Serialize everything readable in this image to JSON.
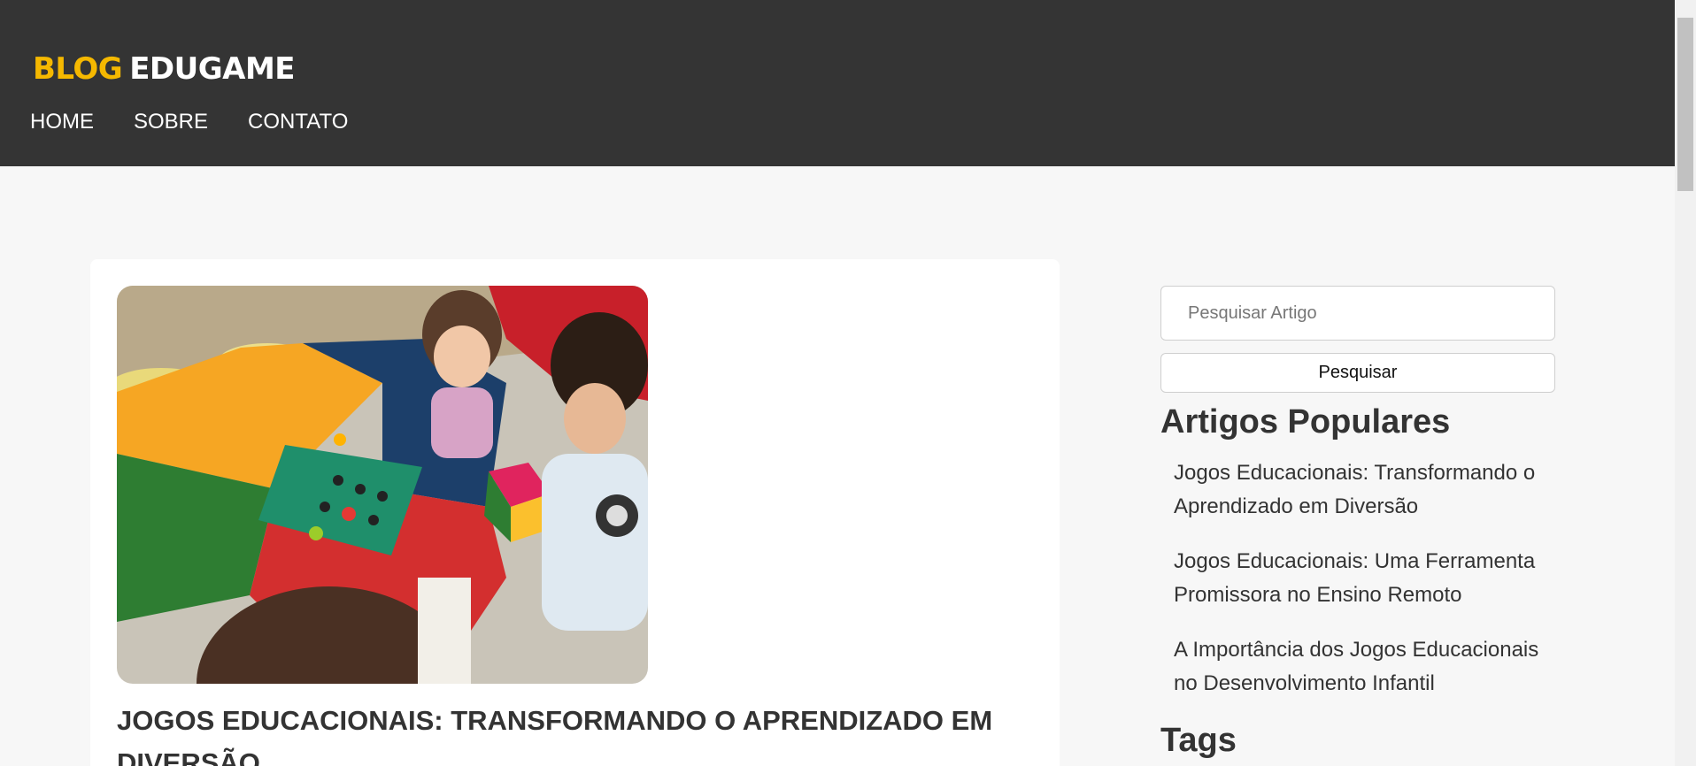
{
  "header": {
    "logo_part1": "BLOG",
    "logo_part2": "EDUGAME",
    "nav": [
      {
        "label": "HOME"
      },
      {
        "label": "SOBRE"
      },
      {
        "label": "CONTATO"
      }
    ]
  },
  "article": {
    "title": "JOGOS EDUCACIONAIS: TRANSFORMANDO O APRENDIZADO EM DIVERSÃO"
  },
  "sidebar": {
    "search_placeholder": "Pesquisar Artigo",
    "search_value": "",
    "search_button": "Pesquisar",
    "popular_title": "Artigos Populares",
    "popular": [
      {
        "label": "Jogos Educacionais: Transformando o Aprendizado em Diversão"
      },
      {
        "label": "Jogos Educacionais: Uma Ferramenta Promissora no Ensino Remoto"
      },
      {
        "label": "A Importância dos Jogos Educacionais no Desenvolvimento Infantil"
      }
    ],
    "tags_title": "Tags"
  },
  "colors": {
    "header_bg": "#343434",
    "logo_accent": "#f5b800",
    "page_bg": "#f7f7f7",
    "card_bg": "#ffffff"
  }
}
